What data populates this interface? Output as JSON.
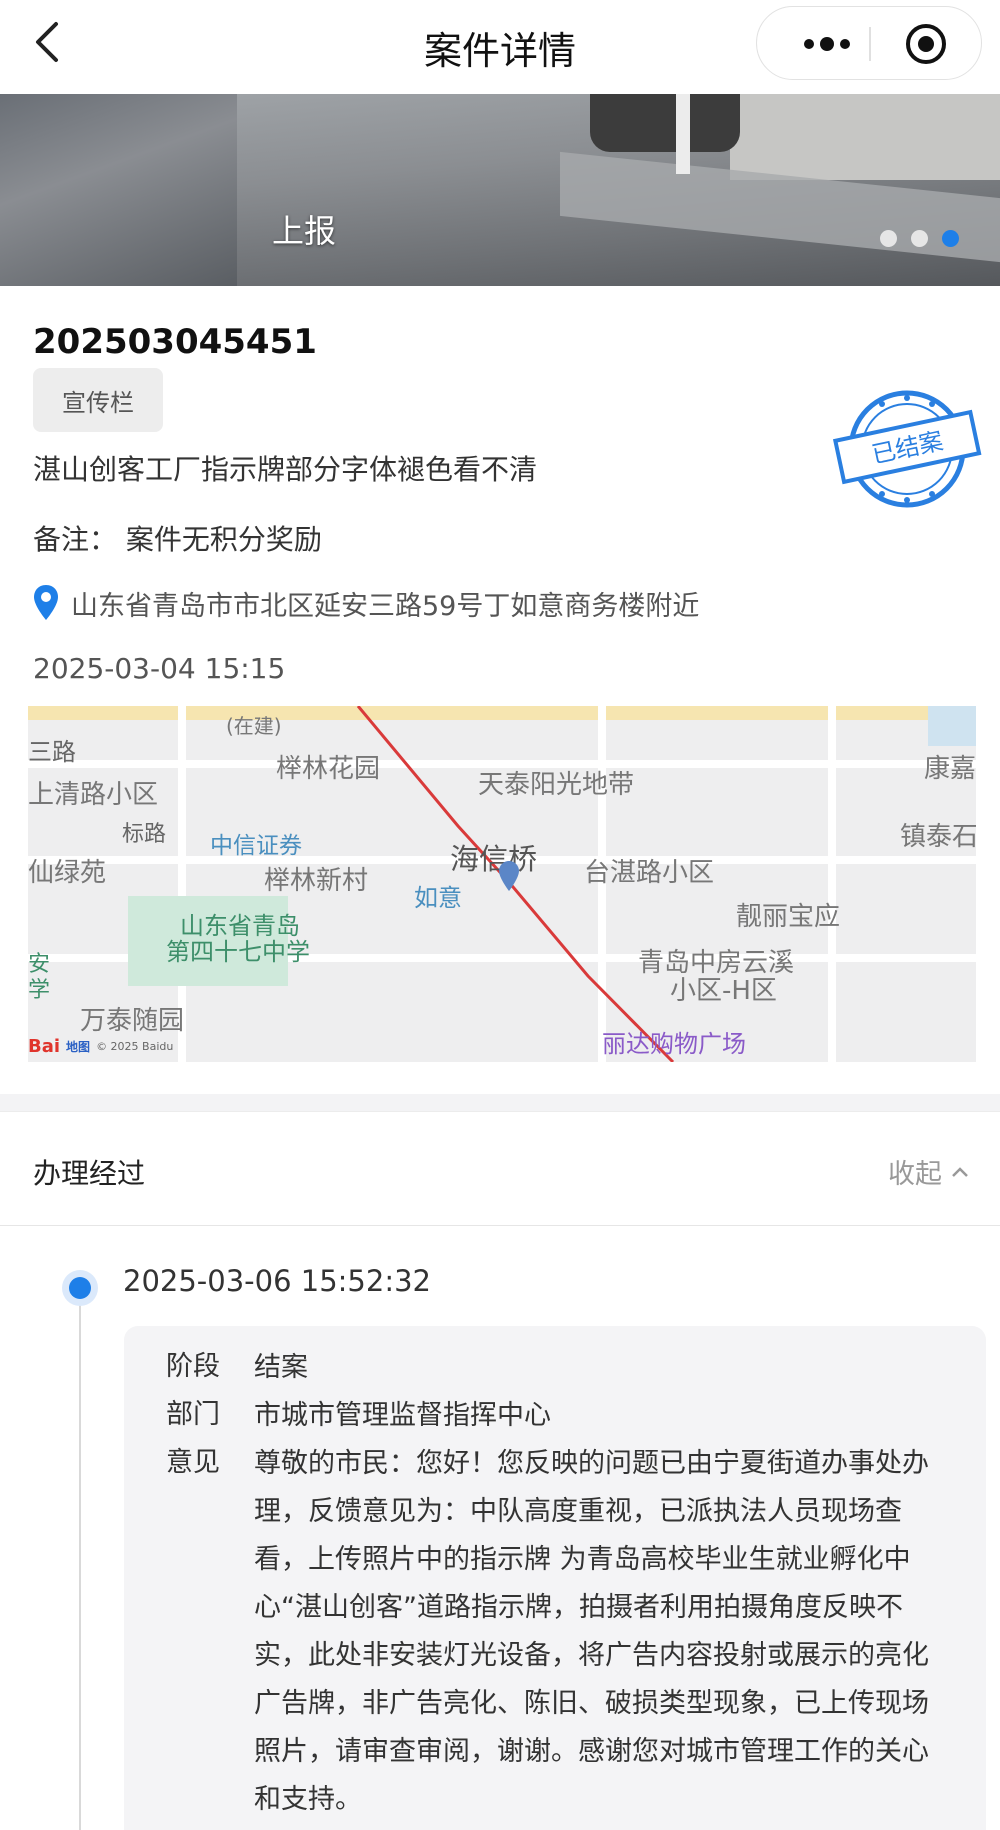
{
  "header": {
    "title": "案件详情"
  },
  "banner": {
    "label": "上报",
    "slide_count": 3,
    "active_slide": 3
  },
  "case": {
    "number": "202503045451",
    "category_tag": "宣传栏",
    "description": "湛山创客工厂指示牌部分字体褪色看不清",
    "remark": "备注： 案件无积分奖励",
    "address": "山东省青岛市市北区延安三路59号丁如意商务楼附近",
    "time": "2025-03-04 15:15",
    "stamp_text": "已结案"
  },
  "map": {
    "labels": [
      "(在建)",
      "三路",
      "榉林花园",
      "天泰阳光地带",
      "康嘉",
      "上清路小区",
      "标路",
      "中信证券",
      "镇泰石",
      "海信桥",
      "仙绿苑",
      "榉林新村",
      "台湛路小区",
      "如意",
      "靓丽宝应",
      "山东省青岛",
      "第四十七中学",
      "安",
      "学",
      "青岛中房云溪",
      "小区-H区",
      "万泰随园",
      "丽达购物广场"
    ],
    "provider_logo": "Bai",
    "provider_logo_tail": "地图",
    "copyright": "© 2025 Baidu"
  },
  "process": {
    "title": "办理经过",
    "collapse_label": "收起",
    "entries": [
      {
        "time": "2025-03-06 15:52:32",
        "stage_key": "阶段",
        "stage": "结案",
        "dept_key": "部门",
        "dept": "市城市管理监督指挥中心",
        "opinion_key": "意见",
        "opinion": "尊敬的市民：您好！您反映的问题已由宁夏街道办事处办理，反馈意见为：中队高度重视，已派执法人员现场查看，上传照片中的指示牌 为青岛高校毕业生就业孵化中心“湛山创客”道路指示牌，拍摄者利用拍摄角度反映不实，此处非安装灯光设备，将广告内容投射或展示的亮化广告牌，非广告亮化、陈旧、破损类型现象，已上传现场照片，请审查审阅，谢谢。感谢您对城市管理工作的关心和支持。"
      }
    ]
  },
  "colors": {
    "accent": "#1e7fe8",
    "stamp": "#2a7fe0",
    "route": "#d93a3a"
  }
}
